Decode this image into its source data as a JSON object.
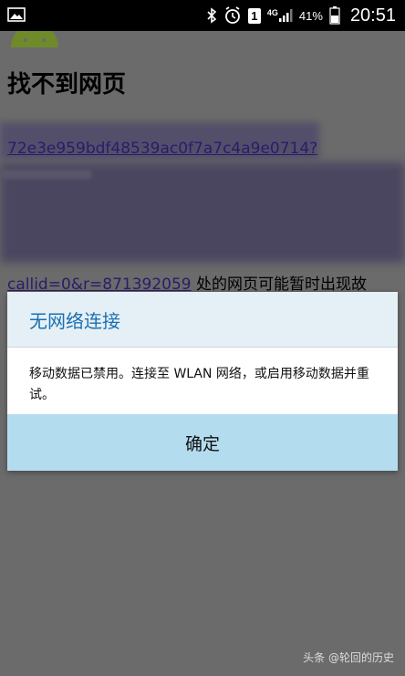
{
  "status_bar": {
    "battery": "41%",
    "time": "20:51",
    "sim": "1",
    "network": "4G",
    "icons": [
      "picture-icon",
      "bluetooth-icon",
      "alarm-icon",
      "sim-icon",
      "signal-icon",
      "battery-icon"
    ]
  },
  "page": {
    "title": "找不到网页",
    "link_fragment_1": "72e3e959bdf48539ac0f7a7c4a9e0714?",
    "link_fragment_2": "callid=0&r=871392059",
    "body_suffix": " 处的网页可能暂时出现故"
  },
  "dialog": {
    "title": "无网络连接",
    "message": "移动数据已禁用。连接至 WLAN 网络，或启用移动数据并重试。",
    "ok_label": "确定"
  },
  "watermark": "头条 @轮回的历史",
  "colors": {
    "overlay_bg": "#6b6b6b",
    "dialog_header_bg": "#e4f0f6",
    "dialog_title": "#1c6fb0",
    "dialog_button_bg": "#b4dcef"
  }
}
